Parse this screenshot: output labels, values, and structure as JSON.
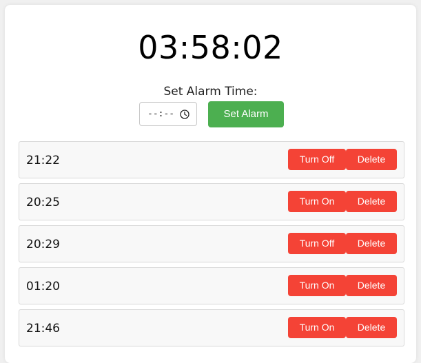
{
  "clock": {
    "time": "03:58:02"
  },
  "setter": {
    "label": "Set Alarm Time:",
    "input_placeholder": "--:--",
    "button_label": "Set Alarm"
  },
  "alarms": [
    {
      "time": "21:22",
      "toggle_label": "Turn Off",
      "delete_label": "Delete"
    },
    {
      "time": "20:25",
      "toggle_label": "Turn On",
      "delete_label": "Delete"
    },
    {
      "time": "20:29",
      "toggle_label": "Turn Off",
      "delete_label": "Delete"
    },
    {
      "time": "01:20",
      "toggle_label": "Turn On",
      "delete_label": "Delete"
    },
    {
      "time": "21:46",
      "toggle_label": "Turn On",
      "delete_label": "Delete"
    }
  ],
  "colors": {
    "set_button": "#4caf50",
    "alarm_button": "#f44336",
    "page_bg": "#f0f0f0"
  },
  "icons": {
    "time_input": "clock-icon"
  }
}
